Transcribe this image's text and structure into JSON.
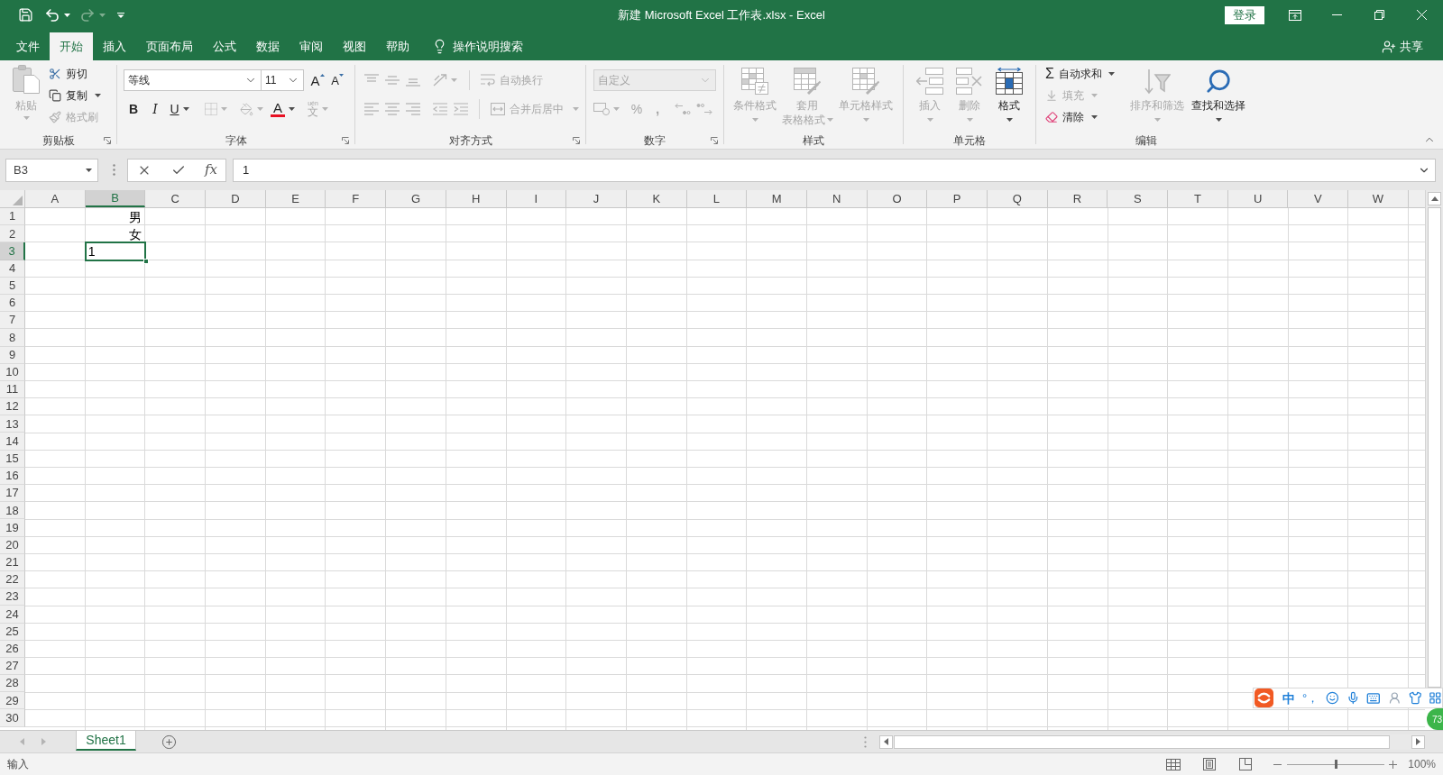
{
  "title_bar": {
    "title": "新建 Microsoft Excel 工作表.xlsx - Excel",
    "undo": {
      "disabled": false
    },
    "redo": {
      "disabled": true
    },
    "sign_in": "登录"
  },
  "menu_tabs": [
    {
      "label": "文件",
      "selected": false
    },
    {
      "label": "开始",
      "selected": true
    },
    {
      "label": "插入",
      "selected": false
    },
    {
      "label": "页面布局",
      "selected": false
    },
    {
      "label": "公式",
      "selected": false
    },
    {
      "label": "数据",
      "selected": false
    },
    {
      "label": "审阅",
      "selected": false
    },
    {
      "label": "视图",
      "selected": false
    },
    {
      "label": "帮助",
      "selected": false
    }
  ],
  "tell_me": {
    "placeholder": "操作说明搜索"
  },
  "share": {
    "label": "共享"
  },
  "ribbon": {
    "clipboard": {
      "label": "剪贴板",
      "paste": {
        "label": "粘贴",
        "disabled": true
      },
      "cut": {
        "label": "剪切",
        "disabled": false
      },
      "copy": {
        "label": "复制",
        "disabled": false
      },
      "format_painter": {
        "label": "格式刷",
        "disabled": true
      }
    },
    "font": {
      "label": "字体",
      "font_name": "等线",
      "font_size": "11",
      "grow_font": {
        "text": "A",
        "disabled": false
      },
      "shrink_font": {
        "text": "A",
        "disabled": false
      },
      "bold": {
        "text": "B",
        "disabled": false
      },
      "italic": {
        "text": "I",
        "disabled": false
      },
      "underline": {
        "text": "U",
        "disabled": false
      },
      "borders": {
        "disabled": true
      },
      "fill_color": {
        "disabled": true
      },
      "font_color": {
        "text": "A",
        "disabled": false
      },
      "phonetic": {
        "text": "文",
        "ruby": "uén",
        "disabled": true
      }
    },
    "alignment": {
      "label": "对齐方式",
      "icons_disabled": true,
      "wrap_text": {
        "label": "自动换行",
        "disabled": true
      },
      "merge_center": {
        "label": "合并后居中",
        "disabled": true
      }
    },
    "number": {
      "label": "数字",
      "format": {
        "value": "自定义",
        "disabled": true
      },
      "icons_disabled": true,
      "percent": "%",
      "comma": ","
    },
    "styles": {
      "label": "样式",
      "buttons": [
        {
          "kind": "conditional_formatting",
          "lines": [
            "条件格式"
          ],
          "disabled": true
        },
        {
          "kind": "format_as_table",
          "lines": [
            "套用",
            "表格格式"
          ],
          "disabled": true
        },
        {
          "kind": "cell_styles",
          "lines": [
            "单元格样式"
          ],
          "disabled": true
        }
      ]
    },
    "cells": {
      "label": "单元格",
      "buttons": [
        {
          "kind": "insert",
          "label": "插入",
          "disabled": true
        },
        {
          "kind": "delete",
          "label": "删除",
          "disabled": true
        },
        {
          "kind": "format",
          "label": "格式",
          "disabled": false
        }
      ]
    },
    "editing": {
      "label": "编辑",
      "autosum": {
        "symbol": "Σ",
        "label": "自动求和",
        "disabled": false
      },
      "fill": {
        "label": "填充",
        "disabled": true
      },
      "clear": {
        "label": "清除",
        "disabled": false
      },
      "sort_filter": {
        "label": "排序和筛选",
        "disabled": true
      },
      "find_select": {
        "label": "查找和选择",
        "disabled": false
      }
    }
  },
  "formula_bar": {
    "name_box": "B3",
    "insert_function": "fx",
    "value": "1"
  },
  "sheet": {
    "columns": [
      {
        "label": "A",
        "selected": false
      },
      {
        "label": "B",
        "selected": true,
        "cells": [
          {
            "value": "男",
            "right_aligned": true,
            "active": false
          },
          {
            "value": "女",
            "right_aligned": true,
            "active": false
          },
          {
            "value": "1",
            "right_aligned": false,
            "active": true
          }
        ]
      },
      {
        "label": "C",
        "selected": false
      },
      {
        "label": "D",
        "selected": false
      },
      {
        "label": "E",
        "selected": false
      },
      {
        "label": "F",
        "selected": false
      },
      {
        "label": "G",
        "selected": false
      },
      {
        "label": "H",
        "selected": false
      },
      {
        "label": "I",
        "selected": false
      },
      {
        "label": "J",
        "selected": false
      },
      {
        "label": "K",
        "selected": false
      },
      {
        "label": "L",
        "selected": false
      },
      {
        "label": "M",
        "selected": false
      },
      {
        "label": "N",
        "selected": false
      },
      {
        "label": "O",
        "selected": false
      },
      {
        "label": "P",
        "selected": false
      },
      {
        "label": "Q",
        "selected": false
      },
      {
        "label": "R",
        "selected": false
      },
      {
        "label": "S",
        "selected": false
      },
      {
        "label": "T",
        "selected": false
      },
      {
        "label": "U",
        "selected": false
      },
      {
        "label": "V",
        "selected": false
      },
      {
        "label": "W",
        "selected": false
      }
    ],
    "rows": [
      {
        "label": "1",
        "selected": false
      },
      {
        "label": "2",
        "selected": false
      },
      {
        "label": "3",
        "selected": true
      },
      {
        "label": "4",
        "selected": false
      },
      {
        "label": "5",
        "selected": false
      },
      {
        "label": "6",
        "selected": false
      },
      {
        "label": "7",
        "selected": false
      },
      {
        "label": "8",
        "selected": false
      },
      {
        "label": "9",
        "selected": false
      },
      {
        "label": "10",
        "selected": false
      },
      {
        "label": "11",
        "selected": false
      },
      {
        "label": "12",
        "selected": false
      },
      {
        "label": "13",
        "selected": false
      },
      {
        "label": "14",
        "selected": false
      },
      {
        "label": "15",
        "selected": false
      },
      {
        "label": "16",
        "selected": false
      },
      {
        "label": "17",
        "selected": false
      },
      {
        "label": "18",
        "selected": false
      },
      {
        "label": "19",
        "selected": false
      },
      {
        "label": "20",
        "selected": false
      },
      {
        "label": "21",
        "selected": false
      },
      {
        "label": "22",
        "selected": false
      },
      {
        "label": "23",
        "selected": false
      },
      {
        "label": "24",
        "selected": false
      },
      {
        "label": "25",
        "selected": false
      },
      {
        "label": "26",
        "selected": false
      },
      {
        "label": "27",
        "selected": false
      },
      {
        "label": "28",
        "selected": false
      },
      {
        "label": "29",
        "selected": false
      },
      {
        "label": "30",
        "selected": false
      }
    ]
  },
  "sheet_tabs": [
    {
      "label": "Sheet1",
      "selected": true
    }
  ],
  "status_bar": {
    "mode": "输入",
    "zoom": {
      "level": 0.5,
      "reading": "100%"
    }
  },
  "ime_toolbar": {
    "mode": "中",
    "punctuation": "°，",
    "badge": "73"
  }
}
